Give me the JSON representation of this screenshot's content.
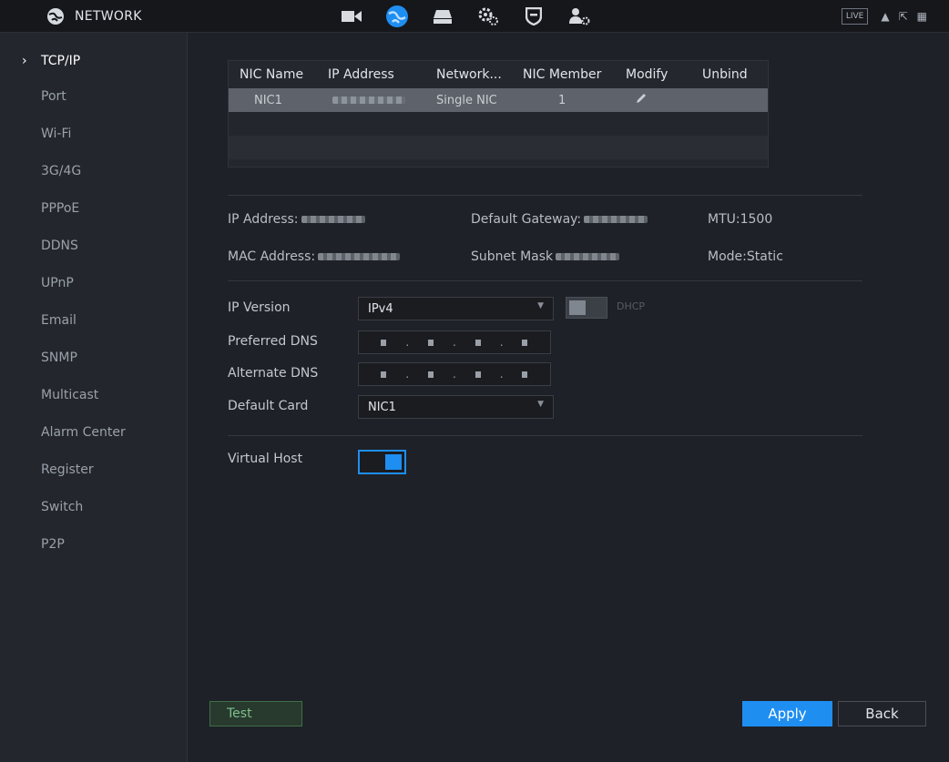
{
  "header": {
    "title": "NETWORK",
    "live_label": "LIVE",
    "nav_icons": [
      "camera-icon",
      "network-globe-icon",
      "storage-icon",
      "settings-gears-icon",
      "security-shield-icon",
      "account-icon"
    ],
    "right_icons": [
      "user-icon",
      "logout-icon",
      "grid-menu-icon"
    ]
  },
  "sidebar": {
    "items": [
      {
        "label": "TCP/IP",
        "active": true
      },
      {
        "label": "Port"
      },
      {
        "label": "Wi-Fi"
      },
      {
        "label": "3G/4G"
      },
      {
        "label": "PPPoE"
      },
      {
        "label": "DDNS"
      },
      {
        "label": "UPnP"
      },
      {
        "label": "Email"
      },
      {
        "label": "SNMP"
      },
      {
        "label": "Multicast"
      },
      {
        "label": "Alarm Center"
      },
      {
        "label": "Register"
      },
      {
        "label": "Switch"
      },
      {
        "label": "P2P"
      }
    ]
  },
  "nic_table": {
    "columns": [
      "NIC Name",
      "IP Address",
      "Network...",
      "NIC Member",
      "Modify",
      "Unbind"
    ],
    "rows": [
      {
        "nic_name": "NIC1",
        "network": "Single NIC",
        "nic_member": "1"
      }
    ]
  },
  "info": {
    "ip_address_label": "IP Address:",
    "default_gateway_label": "Default Gateway:",
    "mtu": "MTU:1500",
    "mac_address_label": "MAC Address:",
    "subnet_mask_label": "Subnet Mask",
    "mode": "Mode:Static"
  },
  "form": {
    "ip_version_label": "IP Version",
    "ip_version_value": "IPv4",
    "dhcp_label": "DHCP",
    "preferred_dns_label": "Preferred DNS",
    "alternate_dns_label": "Alternate DNS",
    "default_card_label": "Default Card",
    "default_card_value": "NIC1",
    "virtual_host_label": "Virtual Host"
  },
  "footer": {
    "test_label": "Test",
    "apply_label": "Apply",
    "back_label": "Back"
  },
  "colors": {
    "accent": "#1f8ef1",
    "background": "#1e2127",
    "sidebar": "#23262c"
  }
}
